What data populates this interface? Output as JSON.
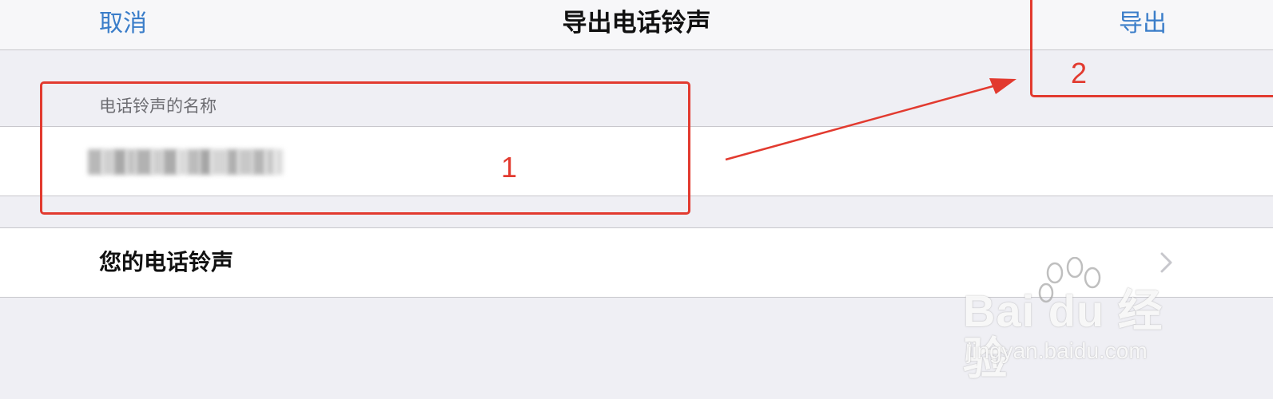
{
  "navbar": {
    "cancel_label": "取消",
    "title": "导出电话铃声",
    "export_label": "导出"
  },
  "form": {
    "section_header": "电话铃声的名称",
    "name_value_blurred": true
  },
  "ringtones": {
    "label": "您的电话铃声",
    "chevron_icon": "chevron-right-icon"
  },
  "annotations": {
    "step1": "1",
    "step2": "2",
    "color": "#e23a2f"
  },
  "watermark": {
    "logo_text": "Bai du 经验",
    "url": "jingyan.baidu.com",
    "paw_icon": "paw-icon"
  },
  "colors": {
    "accent": "#3a7dc9",
    "background": "#efeff4",
    "annotation": "#e23a2f"
  }
}
